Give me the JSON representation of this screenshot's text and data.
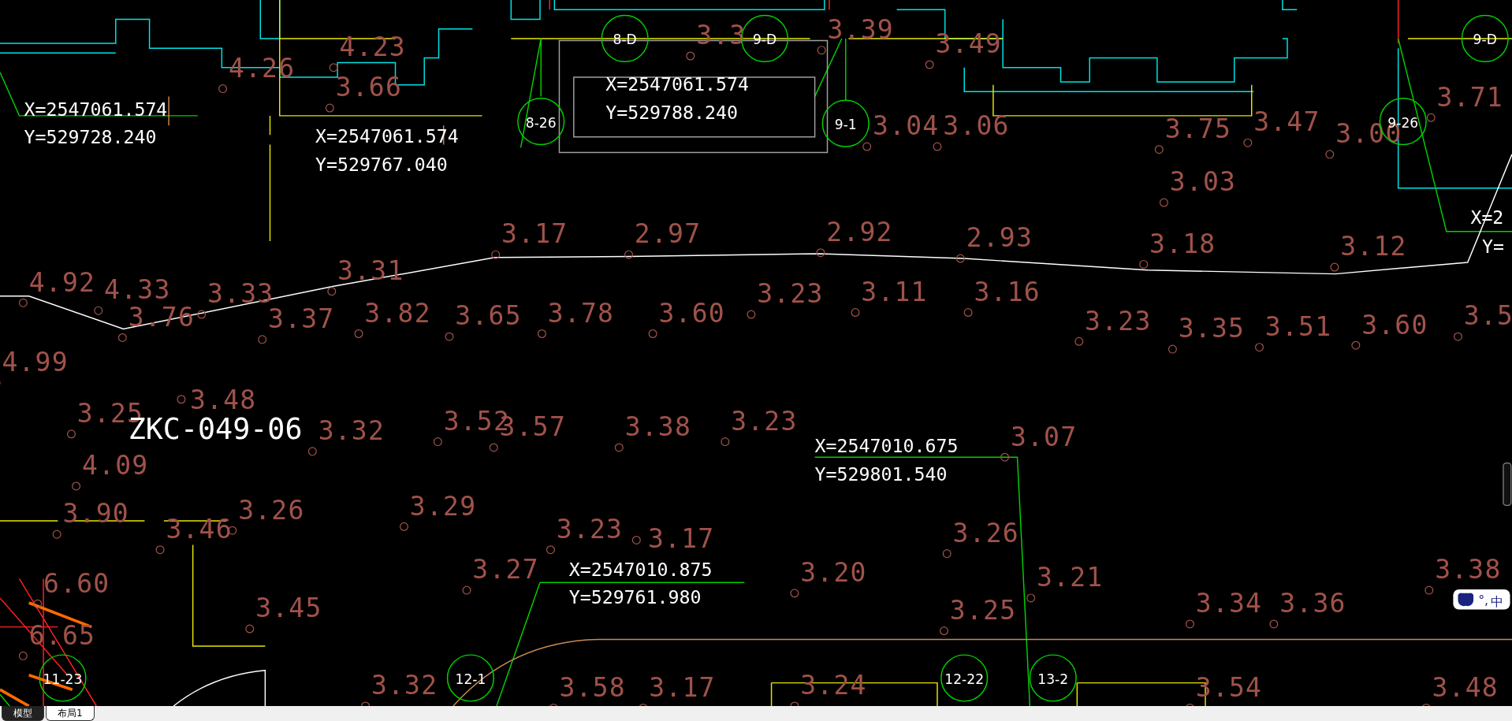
{
  "elevations": [
    "4.23",
    "3.3",
    "3.39",
    "3.49",
    "4.26",
    "3.66",
    "3.71",
    "3.04",
    "3.06",
    "3.75",
    "3.47",
    "3.00",
    "3.03",
    "3.17",
    "2.97",
    "2.92",
    "2.93",
    "3.18",
    "3.12",
    "3.31",
    "4.92",
    "4.33",
    "3.33",
    "3.23",
    "3.11",
    "3.16",
    "3.76",
    "3.37",
    "3.82",
    "3.65",
    "3.78",
    "3.60",
    "3.23",
    "3.35",
    "3.51",
    "3.60",
    "3.5",
    "4.99",
    "3.25",
    "3.48",
    "3.32",
    "3.52",
    "3.57",
    "3.38",
    "3.23",
    "3.07",
    "4.09",
    "3.90",
    "3.26",
    "3.29",
    "3.46",
    "3.23",
    "3.17",
    "3.26",
    "6.60",
    "3.27",
    "3.20",
    "3.21",
    "3.38",
    "3.45",
    "3.25",
    "3.34",
    "3.36",
    "6.65",
    "3.32",
    "3.58",
    "3.17",
    "3.24",
    "3.54",
    "3.48"
  ],
  "coordinates": [
    {
      "x": "X=2547061.574",
      "y": "Y=529728.240"
    },
    {
      "x": "X=2547061.574",
      "y": "Y=529767.040"
    },
    {
      "x": "X=2547061.574",
      "y": "Y=529788.240"
    },
    {
      "x": "X=2547010.675",
      "y": "Y=529801.540"
    },
    {
      "x": "X=2547010.875",
      "y": "Y=529761.980"
    }
  ],
  "axis_markers": [
    "8-D",
    "9-D",
    "9-D",
    "8-26",
    "9-1",
    "9-26",
    "11-23",
    "12-1",
    "12-22",
    "13-2"
  ],
  "borehole_label": "ZKC-049-06",
  "edge_labels": [
    "X=2",
    "Y="
  ],
  "ime": {
    "punctuation": "°,",
    "mode": "中"
  },
  "tabs": [
    {
      "label": "模型",
      "selected": true
    },
    {
      "label": "布局1",
      "selected": false
    }
  ]
}
